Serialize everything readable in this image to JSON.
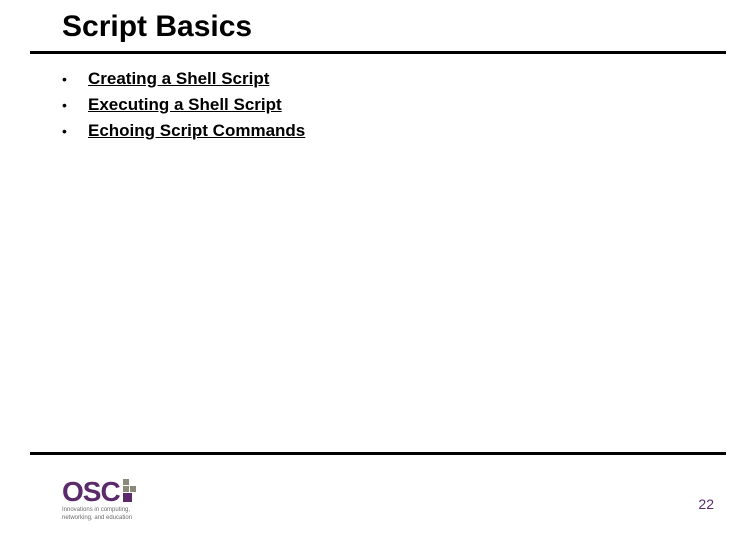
{
  "title": "Script Basics",
  "bullets": [
    {
      "label": "Creating a Shell Script"
    },
    {
      "label": "Executing a Shell Script"
    },
    {
      "label": "Echoing Script Commands"
    }
  ],
  "page_number": "22",
  "logo": {
    "text": "OSC",
    "tagline1": "Innovations in computing,",
    "tagline2": "networking, and education"
  }
}
